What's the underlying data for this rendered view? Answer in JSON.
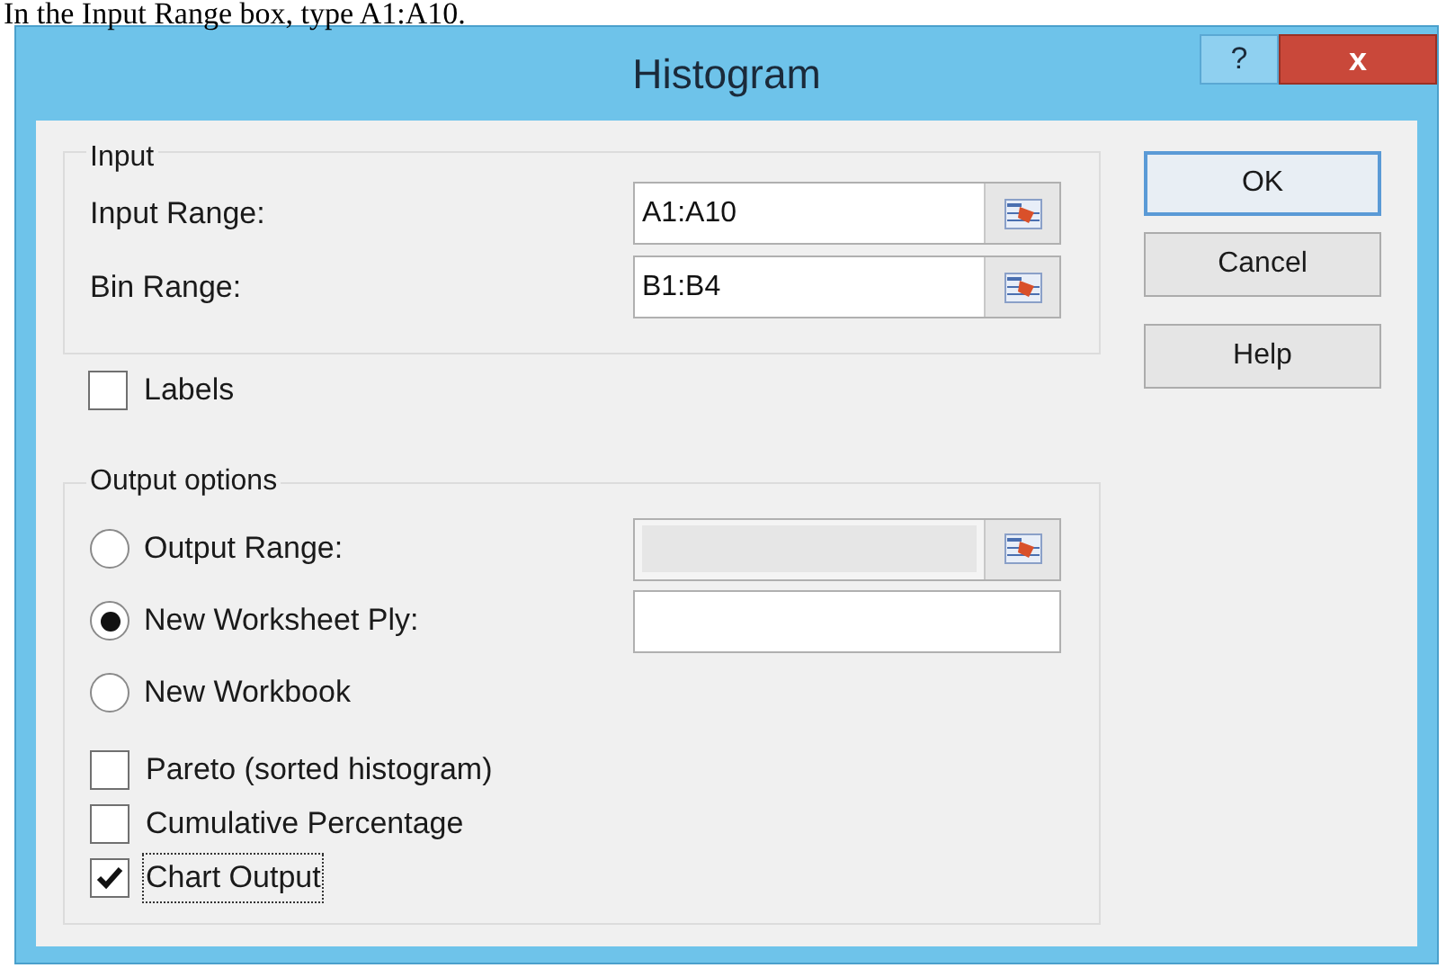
{
  "caption": "In the Input Range box, type A1:A10.",
  "window": {
    "title": "Histogram",
    "title_buttons": [
      {
        "kind": "help",
        "label": "?"
      },
      {
        "kind": "close",
        "label": "x"
      }
    ]
  },
  "input_group": {
    "title": "Input",
    "fields": [
      {
        "label": "Input Range:",
        "value": "A1:A10"
      },
      {
        "label": "Bin Range:",
        "value": "B1:B4"
      }
    ]
  },
  "labels_checkbox": {
    "label": "Labels",
    "checked": false
  },
  "output_group": {
    "title": "Output options",
    "radios": [
      {
        "label": "Output Range:",
        "selected": false,
        "field": {
          "disabled": true,
          "ref_button": true
        }
      },
      {
        "label": "New Worksheet Ply:",
        "selected": true,
        "field": {
          "disabled": false,
          "ref_button": false
        }
      },
      {
        "label": "New Workbook",
        "selected": false
      }
    ],
    "checkboxes": [
      {
        "label": "Pareto (sorted histogram)",
        "checked": false,
        "focused": false
      },
      {
        "label": "Cumulative Percentage",
        "checked": false,
        "focused": false
      },
      {
        "label": "Chart Output",
        "checked": true,
        "focused": true
      }
    ]
  },
  "buttons": [
    {
      "label": "OK",
      "default": true
    },
    {
      "label": "Cancel",
      "default": false
    },
    {
      "label": "Help",
      "default": false
    }
  ]
}
